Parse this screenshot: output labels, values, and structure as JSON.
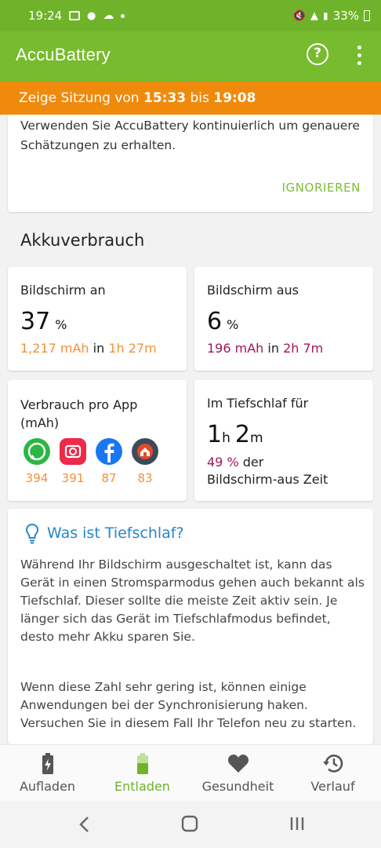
{
  "status": {
    "time": "19:24",
    "battery": "33%"
  },
  "appbar": {
    "title": "AccuBattery",
    "help_glyph": "?"
  },
  "session": {
    "prefix": "Zeige Sitzung von",
    "start": "15:33",
    "middle": "bis",
    "end": "19:08"
  },
  "tip": {
    "text": "Verwenden Sie AccuBattery kontinuierlich um genauere Schätzungen zu erhalten.",
    "action": "IGNORIEREN"
  },
  "section": {
    "title": "Akkuverbrauch"
  },
  "screen_on": {
    "label": "Bildschirm an",
    "percent": "37",
    "unit": "%",
    "mah": "1,217 mAh",
    "in": "in",
    "duration": "1h 27m"
  },
  "screen_off": {
    "label": "Bildschirm aus",
    "percent": "6",
    "unit": "%",
    "mah": "196 mAh",
    "in": "in",
    "duration": "2h 7m"
  },
  "apps": {
    "label": "Verbrauch pro App (mAh)",
    "items": [
      {
        "icon": "whatsapp-icon",
        "value": "394"
      },
      {
        "icon": "instagram-icon",
        "value": "391"
      },
      {
        "icon": "facebook-icon",
        "value": "87"
      },
      {
        "icon": "launcher-icon",
        "value": "83"
      }
    ]
  },
  "deep_sleep": {
    "label": "Im Tiefschlaf für",
    "hours": "1",
    "h_unit": "h",
    "minutes": "2",
    "m_unit": "m",
    "percent": "49 %",
    "percent_rest": "der",
    "line2": "Bildschirm-aus Zeit"
  },
  "info": {
    "title": "Was ist Tiefschlaf?",
    "p1": "Während Ihr Bildschirm ausgeschaltet ist, kann das Gerät in einen Stromsparmodus gehen auch bekannt als Tiefschlaf. Dieser sollte die meiste Zeit aktiv sein. Je länger sich das Gerät im Tiefschlafmodus befindet, desto mehr Akku sparen Sie.",
    "p2": "Wenn diese Zahl sehr gering ist, können einige Anwendungen bei der Synchronisierung haken. Versuchen Sie in diesem Fall Ihr Telefon neu zu starten."
  },
  "nav": {
    "items": [
      "Aufladen",
      "Entladen",
      "Gesundheit",
      "Verlauf"
    ],
    "active": "Entladen"
  },
  "colors": {
    "green": "#77bb2e",
    "orange": "#f08a0c",
    "accent_orange": "#f0913a",
    "purple": "#a0155a",
    "blue": "#2a86c8"
  }
}
